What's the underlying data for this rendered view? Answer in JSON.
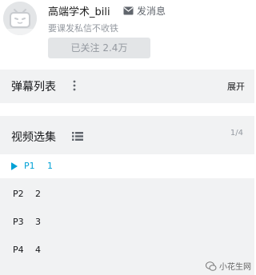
{
  "uploader": {
    "name": "高端学术_bili",
    "message_label": "发消息",
    "signature": "要课发私信不收铁",
    "follow_label": "已关注 2.4万"
  },
  "danmaku": {
    "title": "弹幕列表",
    "expand_label": "展开"
  },
  "video_list": {
    "title": "视频选集",
    "counter": "1/4",
    "episodes": [
      {
        "num": "P1",
        "title": "1",
        "active": true
      },
      {
        "num": "P2",
        "title": "2",
        "active": false
      },
      {
        "num": "P3",
        "title": "3",
        "active": false
      },
      {
        "num": "P4",
        "title": "4",
        "active": false
      }
    ]
  },
  "watermark": {
    "text": "小花生网"
  },
  "colors": {
    "accent": "#00a1d6",
    "panel_bg": "#f1f2f3",
    "muted": "#9499a0"
  }
}
